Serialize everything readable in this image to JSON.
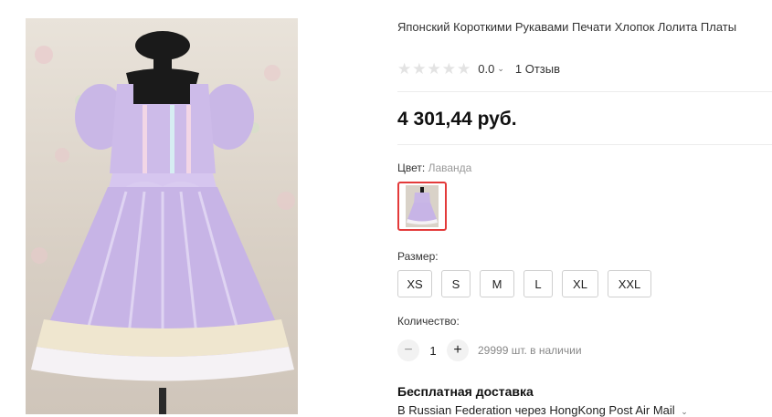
{
  "product": {
    "title": "Японский Короткими Рукавами Печати Хлопок Лолита Платы",
    "image_alt": "lavender lolita dress"
  },
  "rating": {
    "stars_filled": 0,
    "stars_total": 5,
    "value": "0.0",
    "reviews": "1 Отзыв"
  },
  "price": "4 301,44 руб.",
  "color": {
    "label": "Цвет:",
    "value": "Лаванда"
  },
  "size": {
    "label": "Размер:",
    "options": [
      "XS",
      "S",
      "M",
      "L",
      "XL",
      "XXL"
    ]
  },
  "quantity": {
    "label": "Количество:",
    "value": "1",
    "minus": "−",
    "plus": "+",
    "stock": "29999 шт. в наличии"
  },
  "shipping": {
    "title": "Бесплатная доставка",
    "subtitle": "В Russian Federation через HongKong Post Air Mail"
  },
  "colors": {
    "accent_border": "#e33a3a",
    "dress_lavender": "#c9b7e6"
  }
}
